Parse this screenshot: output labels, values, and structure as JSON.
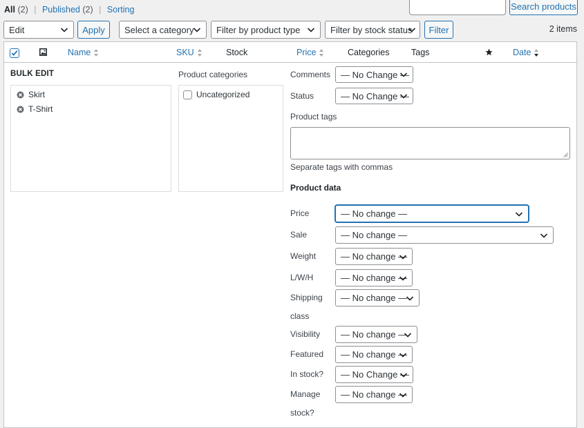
{
  "views": {
    "all_label": "All",
    "all_count": "(2)",
    "published_label": "Published",
    "published_count": "(2)",
    "sorting_label": "Sorting",
    "separator": "|"
  },
  "search": {
    "button_label": "Search products",
    "value": ""
  },
  "toolbar": {
    "bulk_action": "Edit",
    "apply_label": "Apply",
    "category_filter": "Select a category",
    "type_filter": "Filter by product type",
    "stock_filter": "Filter by stock status",
    "filter_label": "Filter",
    "items_count": "2 items"
  },
  "columns": {
    "name": "Name",
    "sku": "SKU",
    "stock": "Stock",
    "price": "Price",
    "categories": "Categories",
    "tags": "Tags",
    "date": "Date"
  },
  "bulk_edit": {
    "title": "BULK EDIT",
    "products": [
      "Skirt",
      "T-Shirt"
    ],
    "categories_label": "Product categories",
    "categories": [
      "Uncategorized"
    ],
    "comments_label": "Comments",
    "comments_value": "— No Change —",
    "status_label": "Status",
    "status_value": "— No Change —",
    "tags_label": "Product tags",
    "tags_value": "",
    "tags_hint": "Separate tags with commas",
    "product_data_label": "Product data",
    "fields": {
      "price": {
        "label": "Price",
        "value": "— No change —"
      },
      "sale": {
        "label": "Sale",
        "value": "— No change —"
      },
      "weight": {
        "label": "Weight",
        "value": "— No change —"
      },
      "lwh": {
        "label": "L/W/H",
        "value": "— No change —"
      },
      "shipping": {
        "label1": "Shipping",
        "label2": "class",
        "value": "— No change —"
      },
      "visibility": {
        "label": "Visibility",
        "value": "— No change —"
      },
      "featured": {
        "label": "Featured",
        "value": "— No change —"
      },
      "in_stock": {
        "label": "In stock?",
        "value": "— No Change —"
      },
      "manage": {
        "label1": "Manage",
        "label2": "stock?",
        "value": "— No change —"
      }
    }
  },
  "colors": {
    "accent": "#2271b1",
    "border": "#8c8f94",
    "background": "#f0f0f1"
  }
}
